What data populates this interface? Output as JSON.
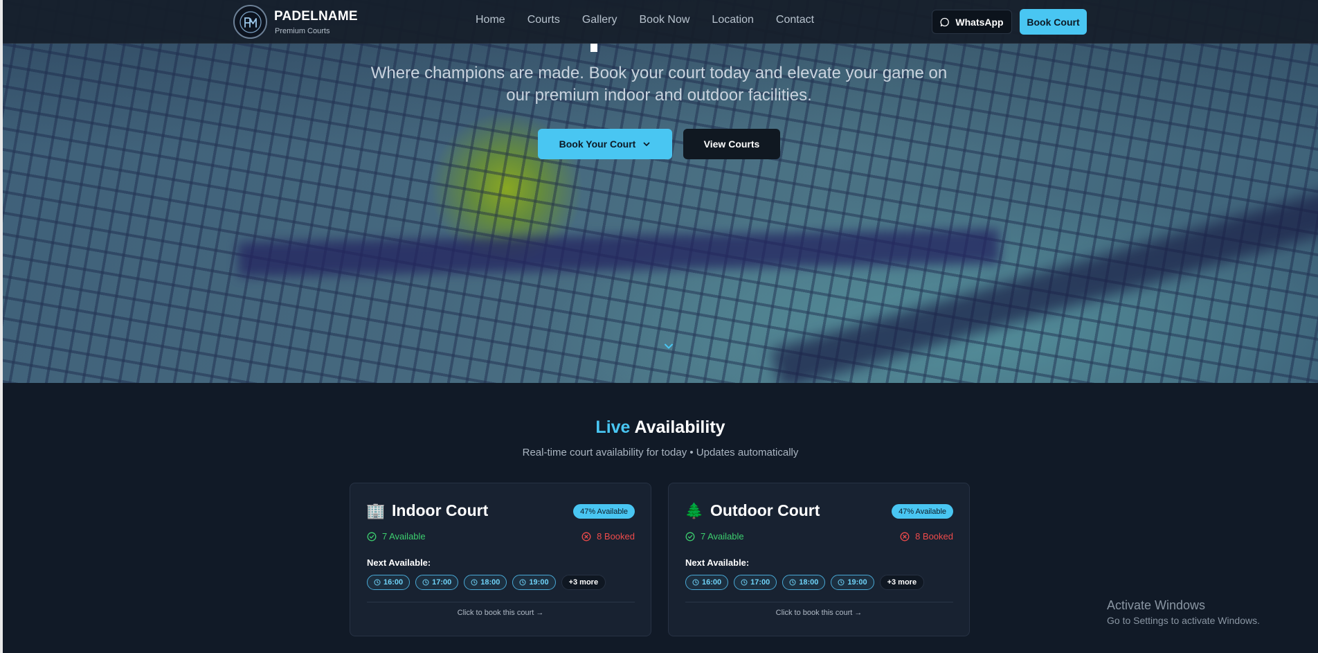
{
  "header": {
    "brand_name": "PADELNAME",
    "brand_sub": "Premium Courts",
    "logo_text": "PM",
    "nav": [
      {
        "label": "Home"
      },
      {
        "label": "Courts"
      },
      {
        "label": "Gallery"
      },
      {
        "label": "Book Now"
      },
      {
        "label": "Location"
      },
      {
        "label": "Contact"
      }
    ],
    "whatsapp_label": "WhatsApp",
    "book_court_label": "Book Court"
  },
  "hero": {
    "subtitle_line1": "Where champions are made. Book your court today and elevate your game on",
    "subtitle_line2": "our premium indoor and outdoor facilities.",
    "primary_button": "Book Your Court",
    "secondary_button": "View Courts"
  },
  "availability": {
    "title_accent": "Live",
    "title_rest": "Availability",
    "subtitle": "Real-time court availability for today • Updates automatically",
    "next_label": "Next Available:",
    "cta": "Click to book this court →",
    "courts": [
      {
        "emoji": "🏢",
        "name": "Indoor Court",
        "badge": "47% Available",
        "available": "7 Available",
        "booked": "8 Booked",
        "slots": [
          "16:00",
          "17:00",
          "18:00",
          "19:00"
        ],
        "more": "+3 more"
      },
      {
        "emoji": "🌲",
        "name": "Outdoor Court",
        "badge": "47% Available",
        "available": "7 Available",
        "booked": "8 Booked",
        "slots": [
          "16:00",
          "17:00",
          "18:00",
          "19:00"
        ],
        "more": "+3 more"
      }
    ]
  },
  "watermark": {
    "line1": "Activate Windows",
    "line2": "Go to Settings to activate Windows."
  },
  "colors": {
    "accent": "#49c6f2",
    "available": "#3dcf6f",
    "booked": "#ef4b4b",
    "background": "#111a27"
  }
}
